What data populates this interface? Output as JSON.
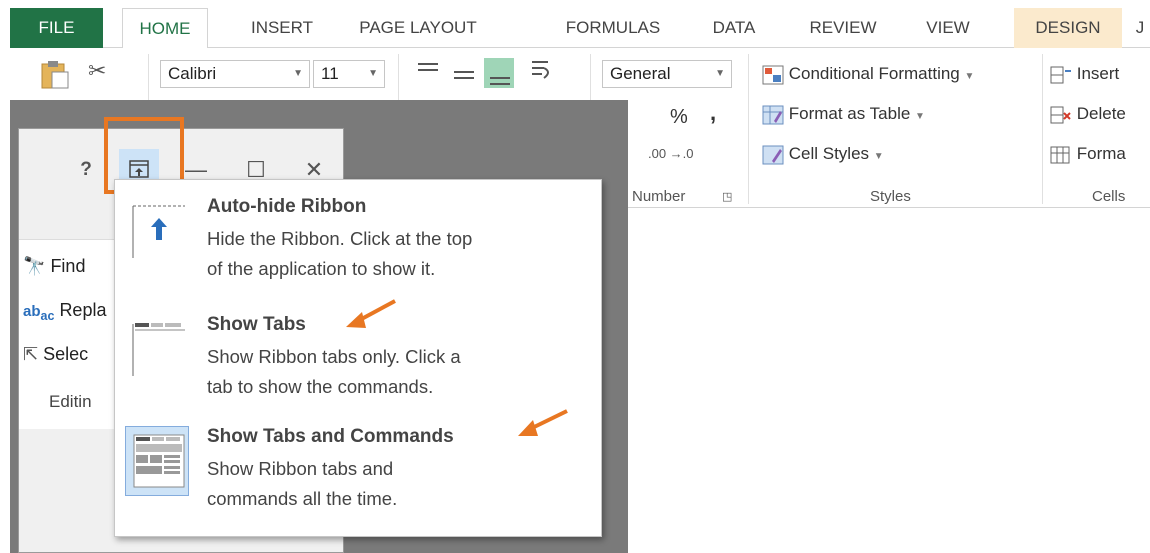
{
  "colors": {
    "excel_green": "#217346",
    "highlight_orange": "#e87722",
    "design_tab": "#fbeacd",
    "selected_item": "#cde3f7"
  },
  "tabs": [
    {
      "label": "FILE"
    },
    {
      "label": "HOME"
    },
    {
      "label": "INSERT"
    },
    {
      "label": "PAGE LAYOUT"
    },
    {
      "label": "FORMULAS"
    },
    {
      "label": "DATA"
    },
    {
      "label": "REVIEW"
    },
    {
      "label": "VIEW"
    },
    {
      "label": "DESIGN"
    },
    {
      "label": "J"
    }
  ],
  "ribbon": {
    "font_name": "Calibri",
    "font_size": "11",
    "number_format": "General",
    "percent": "%",
    "comma": ",",
    "decimals": ".00 →.0",
    "number_group": "Number",
    "styles": {
      "conditional": "Conditional Formatting",
      "format_table": "Format as Table",
      "cell_styles": "Cell Styles",
      "group": "Styles"
    },
    "cells": {
      "insert": "Insert",
      "delete": "Delete",
      "format": "Forma",
      "group": "Cells"
    }
  },
  "window": {
    "help": "?",
    "minimize": "—",
    "maximize": "☐",
    "close": "✕"
  },
  "editing": {
    "find": "Find",
    "replace": "Repla",
    "select": "Selec",
    "group": "Editin"
  },
  "menu": {
    "items": [
      {
        "title": "Auto-hide Ribbon",
        "desc1": "Hide the Ribbon. Click at the top",
        "desc2": "of the application to show it."
      },
      {
        "title": "Show Tabs",
        "desc1": "Show Ribbon tabs only. Click a",
        "desc2": "tab to show the commands."
      },
      {
        "title": "Show Tabs and Commands",
        "desc1": "Show Ribbon tabs and",
        "desc2": "commands all the time."
      }
    ]
  }
}
